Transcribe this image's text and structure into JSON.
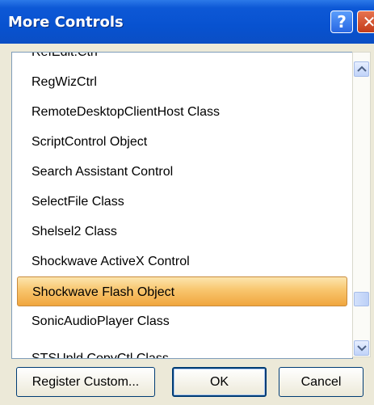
{
  "window": {
    "title": "More Controls",
    "help_label": "?",
    "close_label": "✕"
  },
  "list": {
    "items": [
      "RefEdit.Ctrl",
      "RegWizCtrl",
      "RemoteDesktopClientHost Class",
      "ScriptControl Object",
      "Search Assistant Control",
      "SelectFile Class",
      "Shelsel2 Class",
      "Shockwave ActiveX Control",
      "Shockwave Flash Object",
      "SonicAudioPlayer Class",
      "STSUpld.CopyCtl Class"
    ],
    "selected_item": "Shockwave Flash Object"
  },
  "buttons": {
    "register_custom": "Register Custom...",
    "ok": "OK",
    "cancel": "Cancel"
  },
  "icons": {
    "scroll_up": "up-arrow-icon",
    "scroll_down": "down-arrow-icon"
  },
  "colors": {
    "titlebar": "#0852d0",
    "selection": "#f8c56e",
    "dialog_bg": "#ece9d8"
  }
}
